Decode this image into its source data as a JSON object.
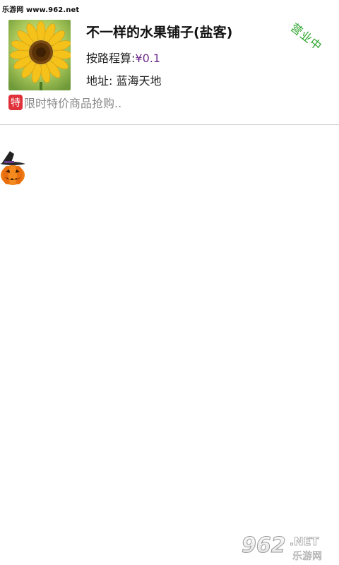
{
  "watermark_top": "乐游网 www.962.net",
  "store": {
    "name": "不一样的水果铺子(盐客)",
    "distance_label": "按路程算:",
    "distance_price": "¥0.1",
    "address": "地址:  蓝海天地",
    "status": "营业中",
    "promo_tag": "特",
    "promo_text": "限时特价商品抢购..",
    "image_icon": "sunflower-image"
  },
  "decoration": {
    "pumpkin_icon": "halloween-pumpkin-icon"
  },
  "watermark_bottom": {
    "brand": "962",
    "suffix": ".NET",
    "subtitle": "乐游网"
  },
  "colors": {
    "status_green": "#2aa32a",
    "promo_red": "#e0303a",
    "price_purple": "#6b2a8a",
    "divider": "#cfcfcf"
  }
}
